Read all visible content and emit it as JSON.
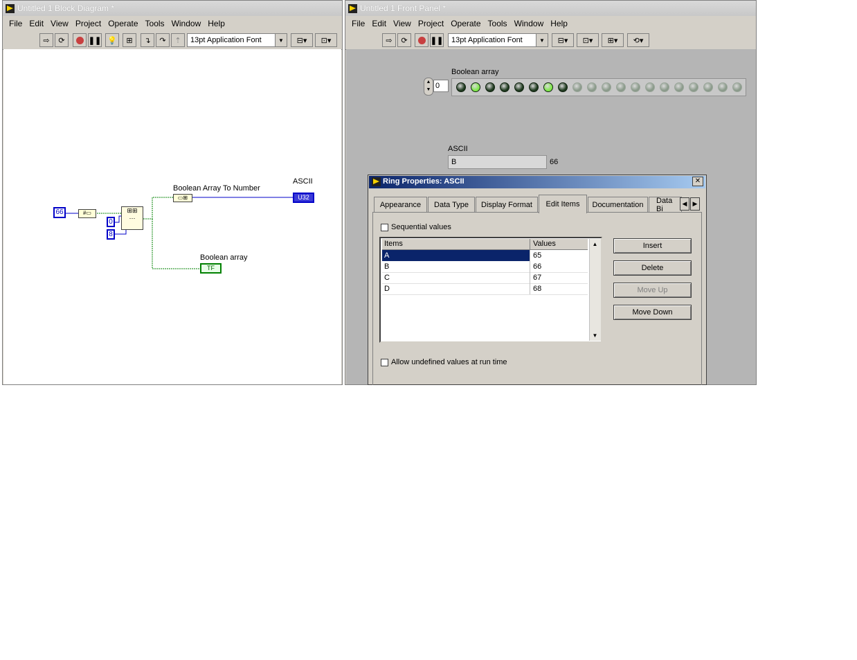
{
  "block_diagram": {
    "title": "Untitled 1 Block Diagram *",
    "menu": [
      "File",
      "Edit",
      "View",
      "Project",
      "Operate",
      "Tools",
      "Window",
      "Help"
    ],
    "font_selector": "13pt Application Font",
    "constant_66": "66",
    "constant_0": "0",
    "constant_8": "8",
    "label_boolean_array_to_number": "Boolean Array To Number",
    "label_ascii": "ASCII",
    "label_boolean_array": "Boolean array",
    "ascii_terminal_type": "U32",
    "boolean_terminal_type": "TF"
  },
  "front_panel": {
    "title": "Untitled 1 Front Panel *",
    "menu": [
      "File",
      "Edit",
      "View",
      "Project",
      "Operate",
      "Tools",
      "Window",
      "Help"
    ],
    "font_selector": "13pt Application Font",
    "boolean_array_label": "Boolean array",
    "array_index": "0",
    "leds": [
      false,
      true,
      false,
      false,
      false,
      false,
      true,
      false,
      null,
      null,
      null,
      null,
      null,
      null,
      null,
      null,
      null,
      null,
      null,
      null
    ],
    "ascii_label": "ASCII",
    "ascii_value": "B",
    "ascii_numeric": "66"
  },
  "dialog": {
    "title": "Ring Properties: ASCII",
    "close_glyph": "✕",
    "tabs": [
      "Appearance",
      "Data Type",
      "Display Format",
      "Edit Items",
      "Documentation",
      "Data Bi"
    ],
    "active_tab": "Edit Items",
    "sequential_values_label": "Sequential values",
    "column_items": "Items",
    "column_values": "Values",
    "rows": [
      {
        "item": "A",
        "value": "65"
      },
      {
        "item": "B",
        "value": "66"
      },
      {
        "item": "C",
        "value": "67"
      },
      {
        "item": "D",
        "value": "68"
      }
    ],
    "insert_label": "Insert",
    "delete_label": "Delete",
    "move_up_label": "Move Up",
    "move_down_label": "Move Down",
    "allow_undefined_label": "Allow undefined values at run time"
  },
  "colors": {
    "led_on": "#7fe84a",
    "led_off": "#1f3a1f",
    "led_disabled": "#8a9a8a",
    "selection": "#0a246a",
    "wire_blue": "#0000c8",
    "wire_green": "#008000"
  }
}
